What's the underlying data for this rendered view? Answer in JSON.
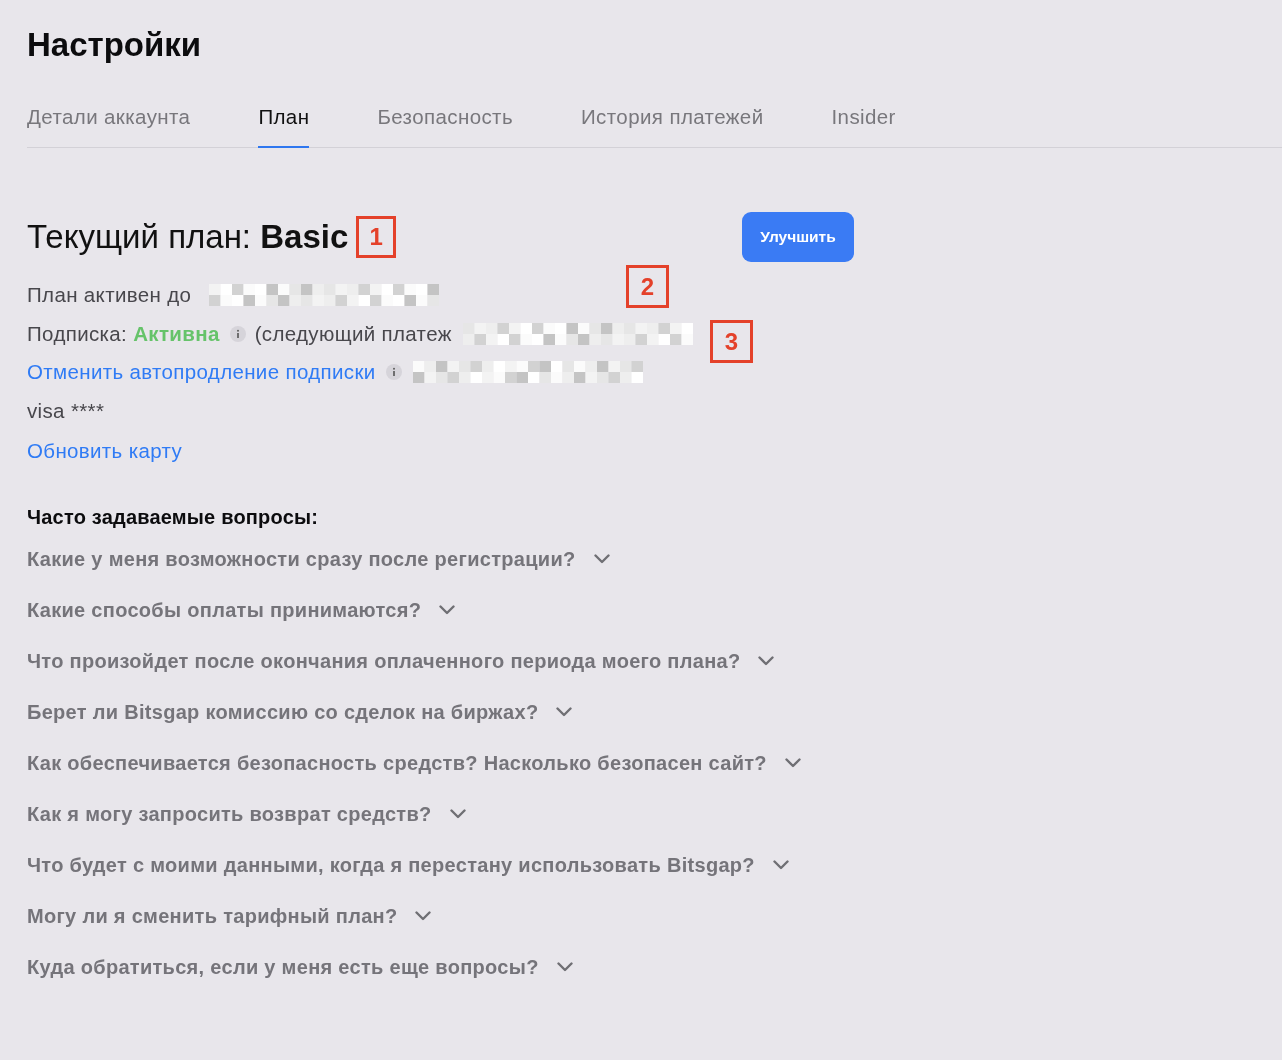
{
  "title": "Настройки",
  "tabs": [
    {
      "label": "Детали аккаунта",
      "selected": false
    },
    {
      "label": "План",
      "selected": true
    },
    {
      "label": "Безопасность",
      "selected": false
    },
    {
      "label": "История платежей",
      "selected": false
    },
    {
      "label": "Insider",
      "selected": false
    }
  ],
  "plan": {
    "heading": "Текущий план: **Basic**",
    "upgrade_button": "Улучшить",
    "active_until": {
      "label": "План активен до",
      "value_redacted": true
    },
    "subscription": {
      "label": "Подписка:",
      "status": "Активна",
      "next_payment_label": "(следующий платеж",
      "value_redacted": true
    },
    "cancel_renewal": {
      "link": "Отменить автопродление подписки",
      "value_redacted": true
    },
    "card": "visa ****",
    "update_card_link": "Обновить карту"
  },
  "annotations": [
    {
      "label": "1"
    },
    {
      "label": "2"
    },
    {
      "label": "3"
    }
  ],
  "faq": {
    "heading": "Часто задаваемые вопросы:",
    "items": [
      {
        "question": "Какие у меня возможности сразу после регистрации?",
        "expanded": false
      },
      {
        "question": "Какие способы оплаты принимаются?",
        "expanded": false
      },
      {
        "question": "Что произойдет после окончания оплаченного периода моего плана?",
        "expanded": false
      },
      {
        "question": "Берет ли Bitsgap комиссию со сделок на биржах?",
        "expanded": false
      },
      {
        "question": "Как обеспечивается безопасность средств? Насколько безопасен сайт?",
        "expanded": false
      },
      {
        "question": "Как я могу запросить возврат средств?",
        "expanded": false
      },
      {
        "question": "Что будет с моими данными, когда я перестану использовать Bitsgap?",
        "expanded": false
      },
      {
        "question": "Могу ли я сменить тарифный план?",
        "expanded": false
      },
      {
        "question": "Куда обратиться, если у меня есть еще вопросы?",
        "expanded": false
      }
    ]
  }
}
